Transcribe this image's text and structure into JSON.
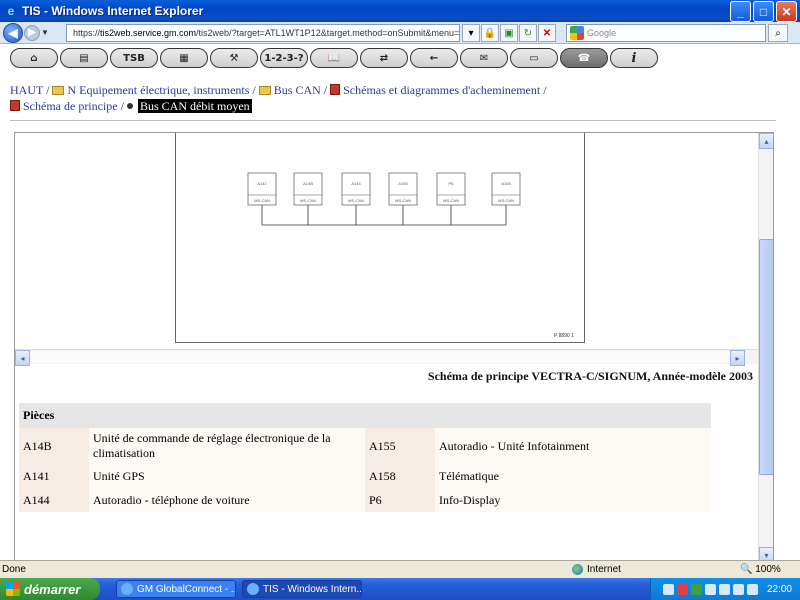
{
  "window": {
    "title": "TIS - Windows Internet Explorer"
  },
  "address_bar": {
    "url_prefix": "https://",
    "url_host": "tis2web.service.gm.com",
    "url_rest": "/tis2web/?target=ATL1WT1P12&target.method=onSubmit&menu=A",
    "search_placeholder": "Google"
  },
  "app_toolbar": {
    "buttons": [
      {
        "name": "home",
        "glyph": "⌂"
      },
      {
        "name": "catalog",
        "glyph": "▤"
      },
      {
        "name": "tsb",
        "glyph": "TSB"
      },
      {
        "name": "manual",
        "glyph": "▦"
      },
      {
        "name": "tools",
        "glyph": "⚒"
      },
      {
        "name": "steps",
        "glyph": "1-2-3-?"
      },
      {
        "name": "book",
        "glyph": "📖"
      },
      {
        "name": "transfer",
        "glyph": "⇄"
      },
      {
        "name": "back",
        "glyph": "←"
      },
      {
        "name": "mail",
        "glyph": "✉"
      },
      {
        "name": "print",
        "glyph": "▭"
      },
      {
        "name": "tech2",
        "glyph": "☎"
      },
      {
        "name": "info",
        "glyph": "i"
      }
    ]
  },
  "breadcrumb": {
    "items": [
      {
        "label": "HAUT",
        "icon": "none"
      },
      {
        "label": "N Equipement électrique, instruments",
        "icon": "folder"
      },
      {
        "label": "Bus CAN",
        "icon": "folder"
      },
      {
        "label": "Schémas et diagrammes d'acheminement",
        "icon": "document"
      },
      {
        "label": "Schéma de principe",
        "icon": "document"
      }
    ],
    "current": "Bus CAN débit moyen",
    "separator": "/"
  },
  "diagram": {
    "figure_id": "P 8890 1",
    "nodes": [
      {
        "id": "A141",
        "bus": "MS-CAN"
      },
      {
        "id": "A14B",
        "bus": "MS-CAN"
      },
      {
        "id": "A144",
        "bus": "MS-CAN"
      },
      {
        "id": "A155",
        "bus": "MS-CAN"
      },
      {
        "id": "P6",
        "bus": "MS-CAN"
      },
      {
        "id": "A158",
        "bus": "MS-CAN"
      }
    ],
    "caption": "Schéma de principe VECTRA-C/SIGNUM, Année-modèle 2003"
  },
  "parts": {
    "header": "Pièces",
    "rows": [
      {
        "code1": "A14B",
        "desc1": "Unité de commande de réglage électronique de la climatisation",
        "code2": "A155",
        "desc2": "Autoradio - Unité Infotainment"
      },
      {
        "code1": "A141",
        "desc1": "Unité GPS",
        "code2": "A158",
        "desc2": "Télématique"
      },
      {
        "code1": "A144",
        "desc1": "Autoradio - téléphone de voiture",
        "code2": "P6",
        "desc2": "Info-Display"
      }
    ]
  },
  "status_bar": {
    "text": "Done",
    "zone": "Internet",
    "zoom": "100%"
  },
  "taskbar": {
    "start_label": "démarrer",
    "tasks": [
      {
        "label": "GM GlobalConnect - ...",
        "active": false
      },
      {
        "label": "TIS - Windows Intern...",
        "active": true
      }
    ],
    "clock": "22:00"
  },
  "colors": {
    "link": "#2a3a9a",
    "titlebar": "#0046c8",
    "taskbar": "#245edb",
    "start": "#2f8a2f"
  }
}
